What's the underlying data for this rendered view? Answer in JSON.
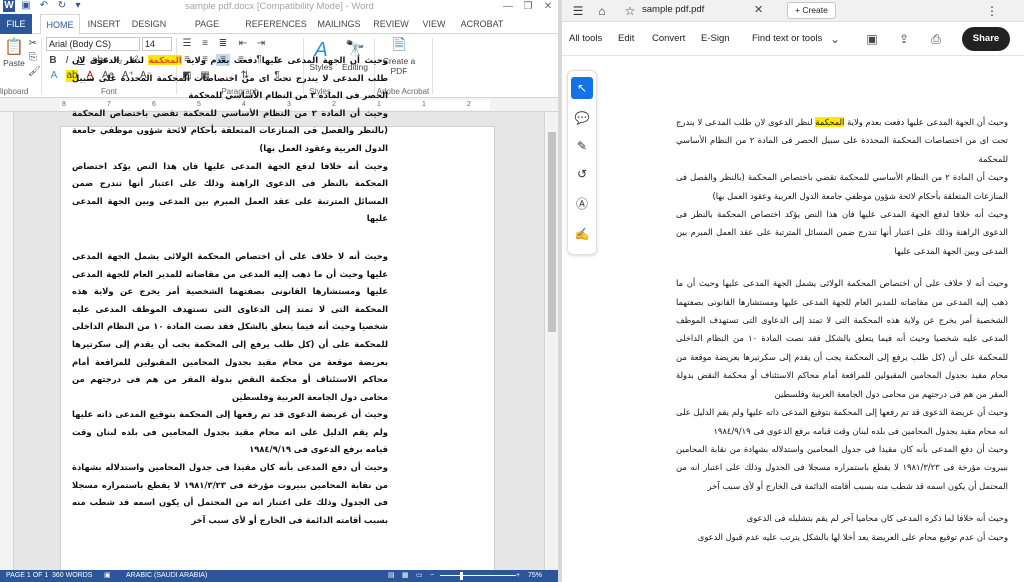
{
  "word": {
    "title": "sample pdf.docx [Compatibility Mode] - Word",
    "tabs": [
      "FILE",
      "HOME",
      "INSERT",
      "DESIGN",
      "PAGE LAYOUT",
      "REFERENCES",
      "MAILINGS",
      "REVIEW",
      "VIEW",
      "ACROBAT"
    ],
    "font_name": "Arial (Body CS)",
    "font_size": "14",
    "groups": {
      "clipboard": "lipboard",
      "font": "Font",
      "paragraph": "Paragraph",
      "styles": "Styles",
      "adobe": "Adobe Acrobat"
    },
    "paste_label": "Paste",
    "styles_label": "Styles",
    "editing_label": "Editing",
    "create_pdf_label": "Create a PDF",
    "ruler_ticks": [
      "8",
      "7",
      "6",
      "5",
      "4",
      "3",
      "2",
      "1",
      "1",
      "2"
    ],
    "status": {
      "page": "PAGE 1 OF 1",
      "words": "360 WORDS",
      "language": "ARABIC (SAUDI ARABIA)",
      "zoom": "75%"
    }
  },
  "reader": {
    "tab_name": "sample pdf.pdf",
    "create_label": "Create",
    "tools": [
      "All tools",
      "Edit",
      "Convert",
      "E-Sign"
    ],
    "find_text": "Find text or tools",
    "share_label": "Share"
  },
  "document": {
    "para1_pre": "وحيث أن الجهة المدعى عليها دفعت بعدم ولاية ",
    "para1_hl": "المحكمة",
    "para1_post": " لنظر الدعوى لان طلب المدعى لا يندرج تحت اى من اختصاصات المحكمة المحددة على سبيل الحصر فى المادة ٢ من النظام الأساسي للمحكمة",
    "para2": "وحيث أن المادة ٢ من النظام الأساسي للمحكمة تقضي باختصاص المحكمة (بالنظر والفصل فى المنازعات المتعلقة بأحكام  لائحة شؤون موظفي جامعة الدول العربية وعقود العمل بها)",
    "para3": "وحيث أنه خلافا لدفع الجهة المدعى عليها فان هذا النص يؤكد اختصاص المحكمة بالنظر فى الدعوى الراهنة وذلك على اعتبار أنها تندرج ضمن المسائل المترتبة على عقد العمل المبرم بين المدعى وبين الجهة المدعى عليها",
    "para4": "وحيث أنه لا خلاف  على أن اختصاص المحكمة الولائى يشمل الجهة المدعى عليها وحيث أن ما ذهب إليه المدعى من مقاضاته للمدير العام للجهة المدعى عليها ومستشارها القانونى بصفتهما الشخصية أمر يخرج عن ولاية هذه المحكمة التى لا تمتد إلى الدعاوى التى تستهدف الموظف المدعى عليه شخصيا وحيث أنه فيما يتعلق بالشكل فقد نصت المادة ١٠ من النظام الداخلى للمحكمة على أن (كل طلب يرفع إلى المحكمة يجب أن يقدم إلى سكرتيرها بعريضة موقعة من محام مقيد بجدول المحامين المقبولين للمرافعة أمام محاكم الاستئناف أو محكمة النقض بدولة المقر من هم فى درجتهم من محامى دول الجامعة العربية وفلسطين",
    "para5": "وحيث أن عريضة الدعوى قد تم رفعها إلى المحكمة بتوقيع المدعى ذاته عليها ولم يقم الدليل على انه محام مقيد بجدول المحامين فى بلده لبنان وقت قيامه برفع الدعوى فى ١٩٨٤/٩/١٩",
    "para6": "وحيث أن دفع المدعى بأنه كان مقيدا فى جدول المحامين واستدلاله بشهادة من نقابة المحامين ببيروت مؤرخة فى ١٩٨١/٣/٢٣ لا يقطع باستمراره مسجلا فى الجدول وذلك على اعتبار انه من المحتمل أن يكون اسمه قد شطب منه بسبب أقامته الدائمة فى الخارج أو لأى سبب آخر",
    "para7": "وحيث أنه خلافا لما ذكره المدعى كان محاميا آخر لم يقم بتشليله فى الدعوى",
    "para8": "وحيث أن عدم توقيع محام على العريضة يعد أخلا لها  بالشكل يترتب عليه عدم قبول الدعوى"
  },
  "colors": {
    "word_blue": "#2b579a",
    "highlight": "#ffe800",
    "acrobat_blue": "#1473e6"
  }
}
